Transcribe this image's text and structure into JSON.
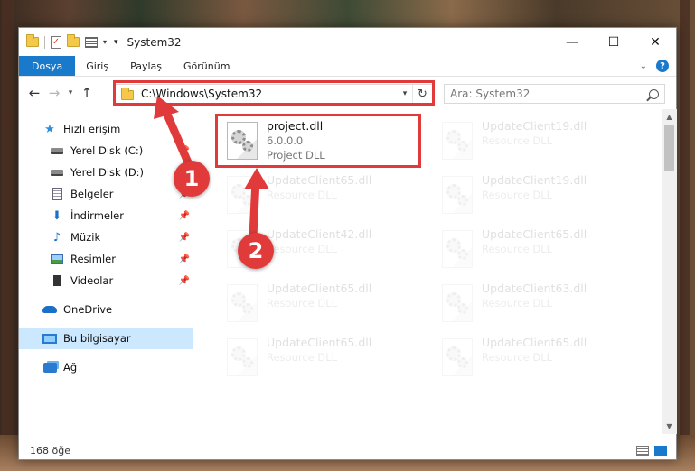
{
  "window": {
    "title": "System32",
    "controls": {
      "minimize": "—",
      "maximize": "☐",
      "close": "✕"
    }
  },
  "ribbon": {
    "tabs": [
      {
        "label": "Dosya"
      },
      {
        "label": "Giriş"
      },
      {
        "label": "Paylaş"
      },
      {
        "label": "Görünüm"
      }
    ],
    "help": "?"
  },
  "navigation": {
    "address": "C:\\Windows\\System32",
    "search_placeholder": "Ara: System32"
  },
  "sidebar": {
    "items": [
      {
        "label": "Hızlı erişim",
        "icon": "star-icon"
      },
      {
        "label": "Yerel Disk (C:)",
        "icon": "drive-icon",
        "pinned": true
      },
      {
        "label": "Yerel Disk (D:)",
        "icon": "drive-icon",
        "pinned": true
      },
      {
        "label": "Belgeler",
        "icon": "document-icon",
        "pinned": true
      },
      {
        "label": "İndirmeler",
        "icon": "download-icon",
        "pinned": true
      },
      {
        "label": "Müzik",
        "icon": "music-icon",
        "pinned": true
      },
      {
        "label": "Resimler",
        "icon": "pictures-icon",
        "pinned": true
      },
      {
        "label": "Videolar",
        "icon": "videos-icon",
        "pinned": true
      },
      {
        "label": "OneDrive",
        "icon": "cloud-icon"
      },
      {
        "label": "Bu bilgisayar",
        "icon": "computer-icon",
        "selected": true
      },
      {
        "label": "Ağ",
        "icon": "network-icon"
      }
    ]
  },
  "files": [
    {
      "name": "project.dll",
      "version": "6.0.0.0",
      "type": "Project DLL"
    },
    {
      "name": "UpdateClient19.dll",
      "type": "Resource DLL"
    },
    {
      "name": "UpdateClient65.dll",
      "type": "Resource DLL"
    },
    {
      "name": "UpdateClient19.dll",
      "type": "Resource DLL"
    },
    {
      "name": "UpdateClient42.dll",
      "type": "Resource DLL"
    },
    {
      "name": "UpdateClient65.dll",
      "type": "Resource DLL"
    },
    {
      "name": "UpdateClient65.dll",
      "type": "Resource DLL"
    },
    {
      "name": "UpdateClient63.dll",
      "type": "Resource DLL"
    },
    {
      "name": "UpdateClient65.dll",
      "type": "Resource DLL"
    },
    {
      "name": "UpdateClient65.dll",
      "type": "Resource DLL"
    }
  ],
  "status": {
    "count": "168 öğe"
  },
  "annotations": {
    "step1": "1",
    "step2": "2",
    "color": "#e03a3a"
  }
}
